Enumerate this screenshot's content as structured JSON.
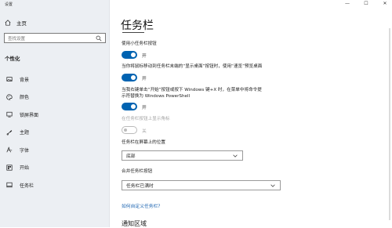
{
  "app": {
    "title": "设置"
  },
  "window_controls": {
    "minimize": "—",
    "maximize": "☐",
    "close": "✕"
  },
  "sidebar": {
    "home_label": "主页",
    "search_placeholder": "查找设置",
    "section_label": "个性化",
    "items": [
      {
        "label": "背景",
        "icon": "image-icon"
      },
      {
        "label": "颜色",
        "icon": "palette-icon"
      },
      {
        "label": "锁屏界面",
        "icon": "lock-screen-icon"
      },
      {
        "label": "主题",
        "icon": "theme-icon"
      },
      {
        "label": "字体",
        "icon": "font-icon"
      },
      {
        "label": "开始",
        "icon": "start-icon"
      },
      {
        "label": "任务栏",
        "icon": "taskbar-icon"
      }
    ]
  },
  "main": {
    "title": "任务栏",
    "settings": [
      {
        "label": "使用小任务栏按钮",
        "state": "开"
      },
      {
        "label": "当你将鼠标移动到任务栏末端的“显示桌面”按钮时，使用“速览”预览桌面",
        "state": "开"
      },
      {
        "label_line1": "当我右键单击“开始”按钮或按下 Windows 键+X 时，在菜单中将命令提",
        "label_line2": "示符替换为 Windows PowerShell",
        "state": "开"
      },
      {
        "label": "在任务栏按钮上显示角标",
        "state": "关"
      }
    ],
    "position": {
      "label": "任务栏在屏幕上的位置",
      "value": "底部"
    },
    "combine": {
      "label": "合并任务栏按钮",
      "value": "任务栏已满时"
    },
    "help_link": "如何自定义任务栏?",
    "next_section": "通知区域"
  },
  "colors": {
    "accent": "#0063b1",
    "link": "#1a63b0",
    "sidebar_bg": "#eceff3"
  }
}
